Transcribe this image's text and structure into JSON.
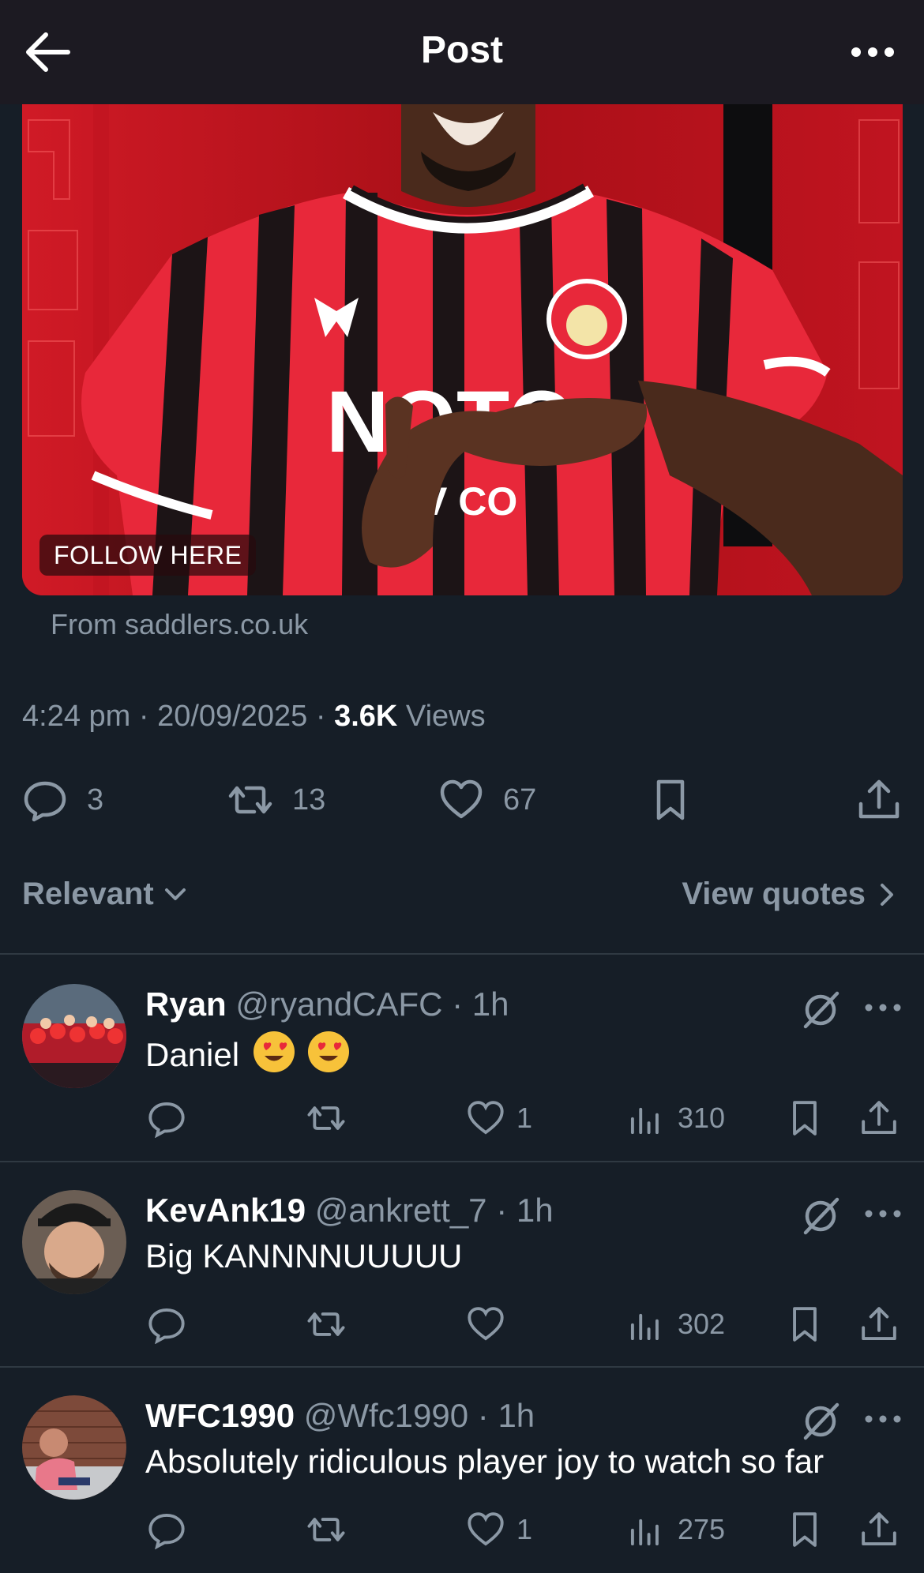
{
  "header": {
    "title": "Post"
  },
  "card": {
    "overlay_label": "FOLLOW HERE",
    "source": "From saddlers.co.uk"
  },
  "meta": {
    "time": "4:24 pm",
    "date": "20/09/2025",
    "views_count": "3.6K",
    "views_label": "Views"
  },
  "actions": {
    "replies": "3",
    "reposts": "13",
    "likes": "67"
  },
  "sort": {
    "label": "Relevant",
    "quotes": "View quotes"
  },
  "replies": [
    {
      "name": "Ryan",
      "handle": "@ryandCAFC",
      "time": "1h",
      "text": "Daniel",
      "emoji": [
        "heart-eyes",
        "heart-eyes"
      ],
      "likes": "1",
      "views": "310"
    },
    {
      "name": "KevAnk19",
      "handle": "@ankrett_7",
      "time": "1h",
      "text": "Big KANNNNUUUUU",
      "likes": "",
      "views": "302"
    },
    {
      "name": "WFC1990",
      "handle": "@Wfc1990",
      "time": "1h",
      "text": "Absolutely ridiculous player joy to watch so far",
      "likes": "1",
      "views": "275"
    }
  ],
  "colors": {
    "background": "#161e27",
    "header": "#1c1a22",
    "muted": "#8b98a5",
    "divider": "#2f3942",
    "jersey_red": "#e8283a"
  }
}
